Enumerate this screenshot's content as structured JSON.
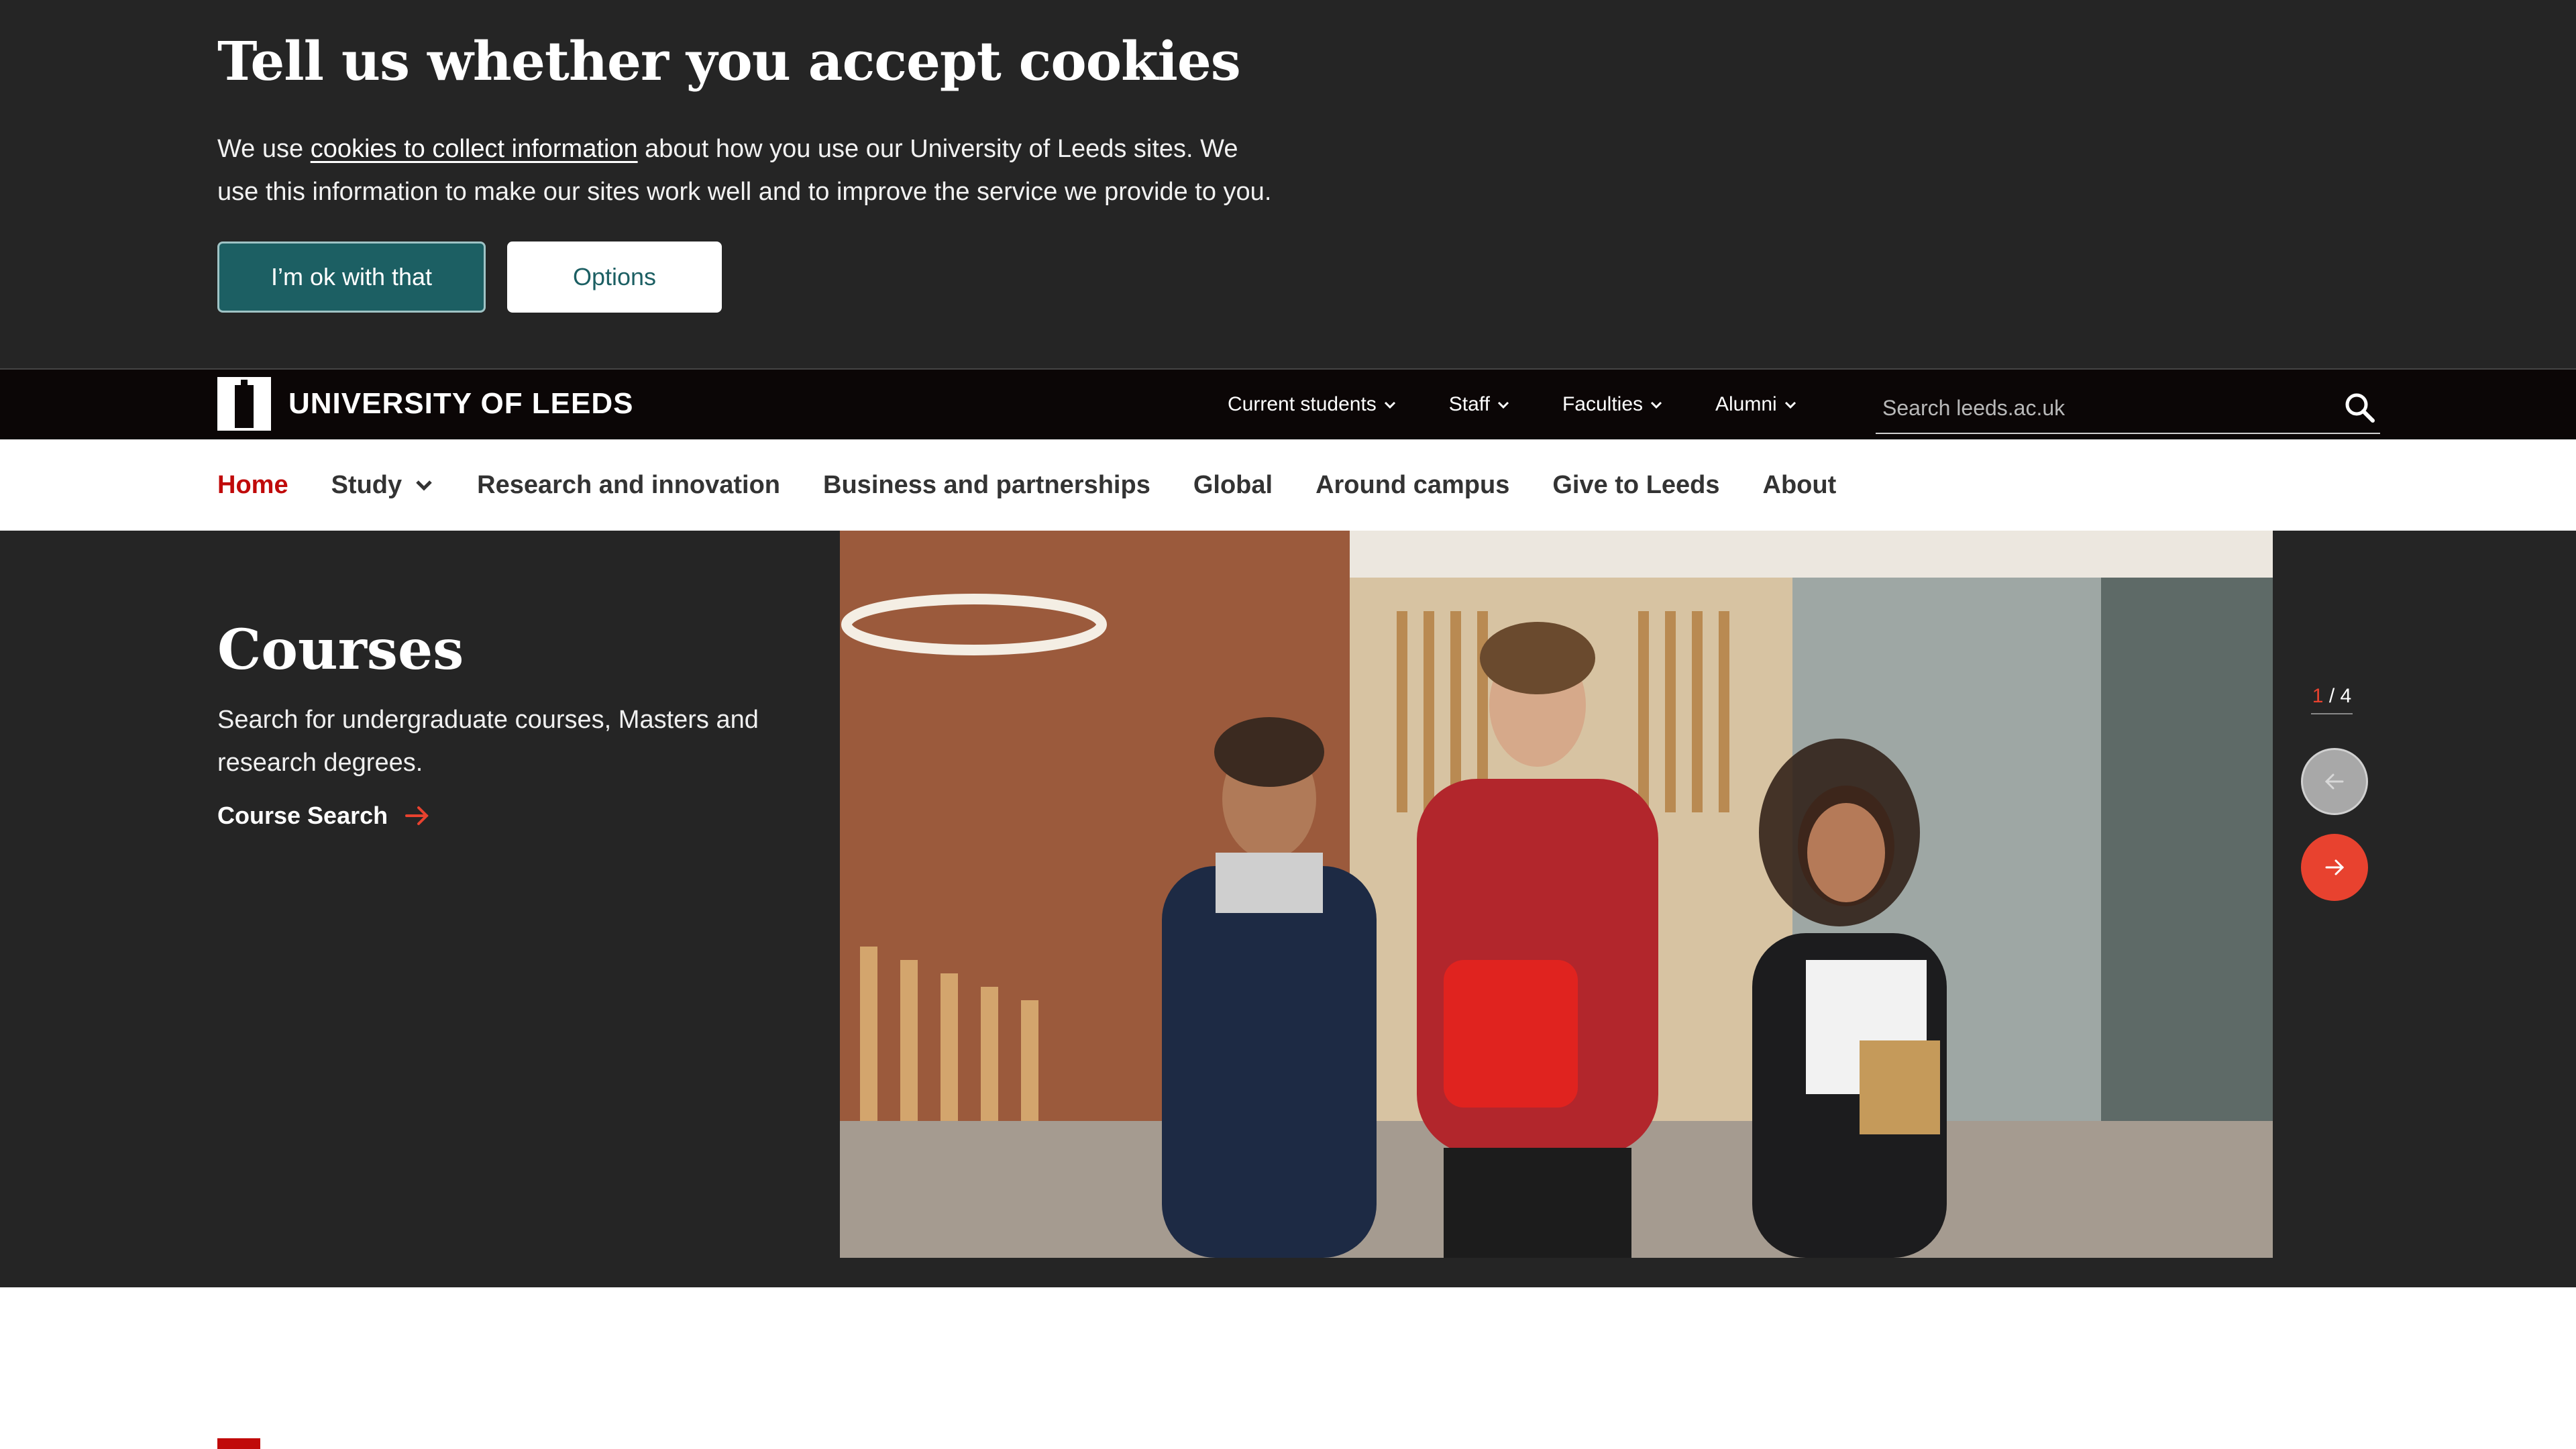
{
  "cookie_banner": {
    "title": "Tell us whether you accept cookies",
    "text_before": "We use ",
    "link": "cookies to collect information",
    "text_after": " about how you use our University of Leeds sites. We use this information to make our sites work well and to improve the service we provide to you.",
    "accept_label": "I’m ok with that",
    "options_label": "Options"
  },
  "header": {
    "logo_text": "UNIVERSITY OF LEEDS",
    "utility_nav": [
      "Current students",
      "Staff",
      "Faculties",
      "Alumni"
    ],
    "search_placeholder": "Search leeds.ac.uk"
  },
  "main_nav": {
    "items": [
      {
        "label": "Home",
        "active": true
      },
      {
        "label": "Study",
        "has_dropdown": true
      },
      {
        "label": "Research and innovation"
      },
      {
        "label": "Business and partnerships"
      },
      {
        "label": "Global"
      },
      {
        "label": "Around campus"
      },
      {
        "label": "Give to Leeds"
      },
      {
        "label": "About"
      }
    ]
  },
  "hero": {
    "title": "Courses",
    "description": "Search for undergraduate courses, Masters and research degrees.",
    "link_label": "Course Search",
    "pager_current": "1",
    "pager_sep": "/",
    "pager_total": "4"
  },
  "colors": {
    "banner_bg": "#252525",
    "accept_button": "#1c5f63",
    "topbar_bg": "#0b0606",
    "active_nav": "#c00a0a",
    "accent_orange": "#e8422f"
  }
}
